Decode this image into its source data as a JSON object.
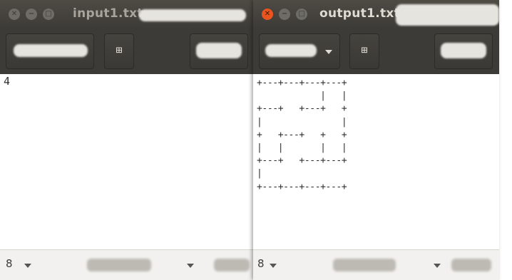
{
  "left_window": {
    "title": "input1.txt",
    "content": "4",
    "status_tab_width": "8"
  },
  "right_window": {
    "title": "output1.txt",
    "content": "+---+---+---+---+\n            |   |\n+---+   +---+   +\n|               |\n+   +---+   +   +\n|   |       |   |\n+---+   +---+---+\n|\n+---+---+---+---+",
    "status_tab_width": "8"
  },
  "icons": {
    "close": "close-icon",
    "minimize": "minimize-icon",
    "maximize": "maximize-icon",
    "new_document": "new-document-icon",
    "dropdown": "chevron-down-icon"
  },
  "colors": {
    "titlebar": "#3d3b37",
    "close_active": "#e9541f",
    "editor_background": "#ffffff",
    "statusbar": "#f2f1ef"
  }
}
